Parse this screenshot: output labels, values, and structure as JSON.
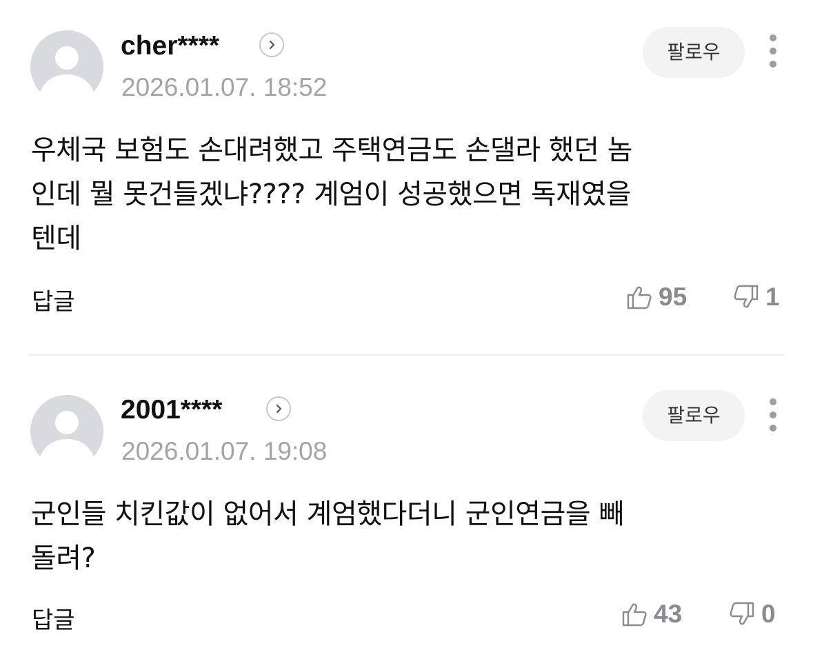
{
  "comments": [
    {
      "username": "cher****",
      "date": "2026.01.07. 18:52",
      "follow_label": "팔로우",
      "text": "우체국 보험도 손대려했고 주택연금도 손댈라 했던 놈\n인데 뭘 못건들겠냐???? 계엄이 성공했으면 독재였을\n텐데",
      "reply_label": "답글",
      "likes": "95",
      "dislikes": "1"
    },
    {
      "username": "2001****",
      "date": "2026.01.07. 19:08",
      "follow_label": "팔로우",
      "text": "군인들 치킨값이 없어서 계엄했다더니 군인연금을 빼\n돌려?",
      "reply_label": "답글",
      "likes": "43",
      "dislikes": "0"
    }
  ],
  "icons": {
    "avatar": "default-user-avatar-icon",
    "profile_link": "chevron-right-icon",
    "more": "more-vertical-icon",
    "like": "thumbs-up-icon",
    "dislike": "thumbs-down-icon"
  },
  "colors": {
    "avatar_bg": "#d9dadd",
    "date_text": "#a3a3a8",
    "vote_text": "#8a8a8f",
    "follow_bg": "#f3f3f4"
  }
}
